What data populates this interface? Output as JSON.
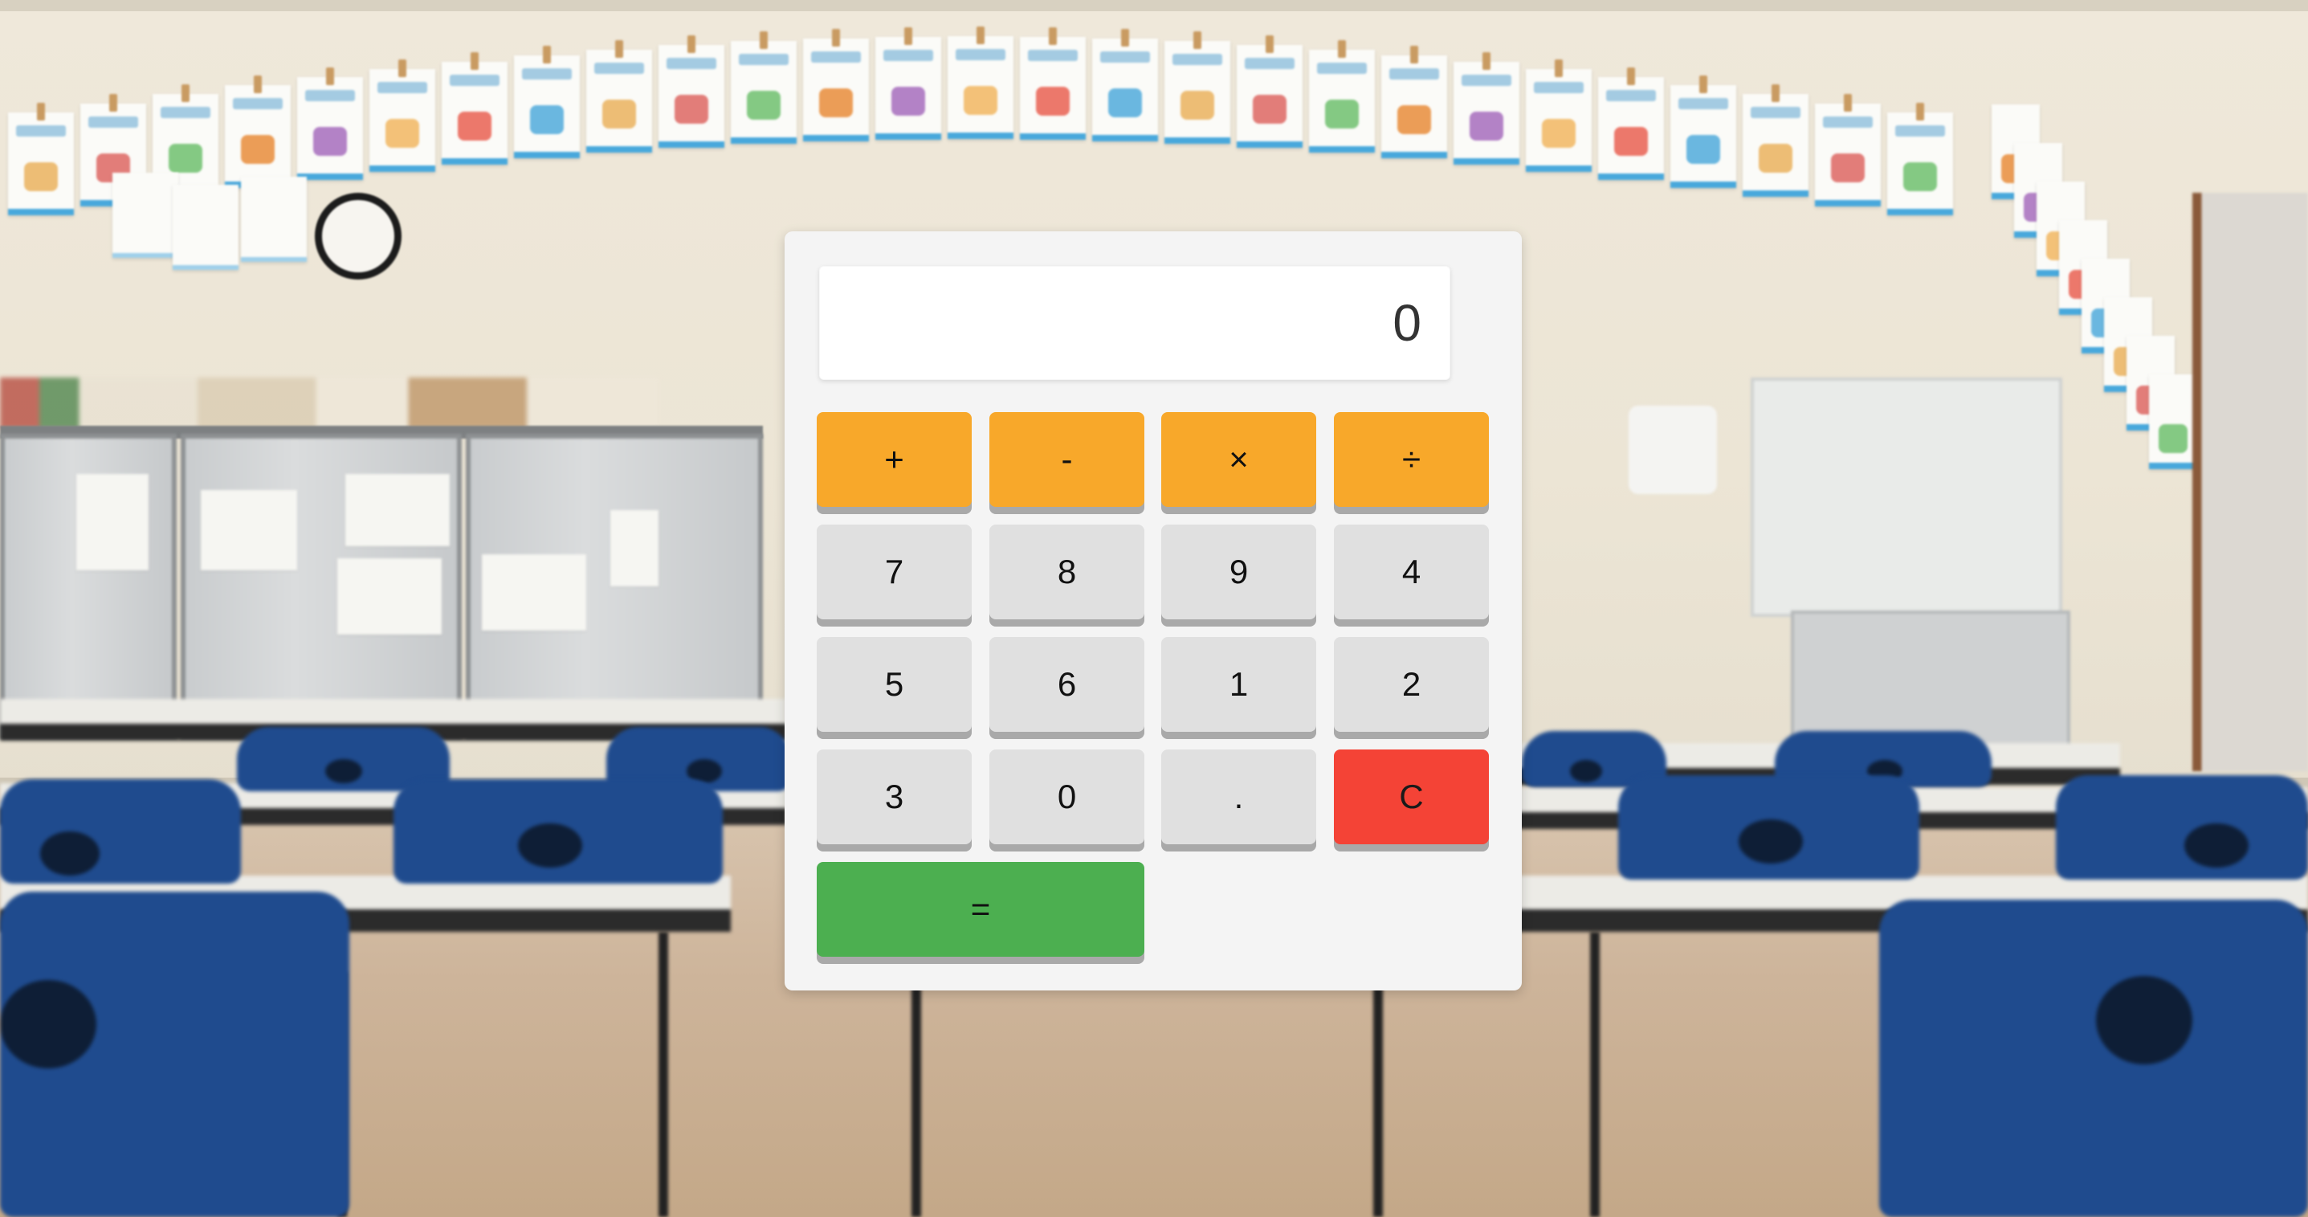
{
  "calculator": {
    "display_value": "0",
    "operator_keys": [
      {
        "label": "+",
        "name": "add"
      },
      {
        "label": "-",
        "name": "subtract"
      },
      {
        "label": "×",
        "name": "multiply"
      },
      {
        "label": "÷",
        "name": "divide"
      }
    ],
    "keys": {
      "seven": "7",
      "eight": "8",
      "nine": "9",
      "four": "4",
      "five": "5",
      "six": "6",
      "one": "1",
      "two": "2",
      "three": "3",
      "zero": "0",
      "decimal": ".",
      "clear": "C",
      "equals": "="
    }
  },
  "colors": {
    "operator": "#f8a82a",
    "number": "#e0e0e0",
    "clear": "#f44336",
    "equals": "#4caf50",
    "panel": "#f4f4f4",
    "display": "#ffffff"
  }
}
